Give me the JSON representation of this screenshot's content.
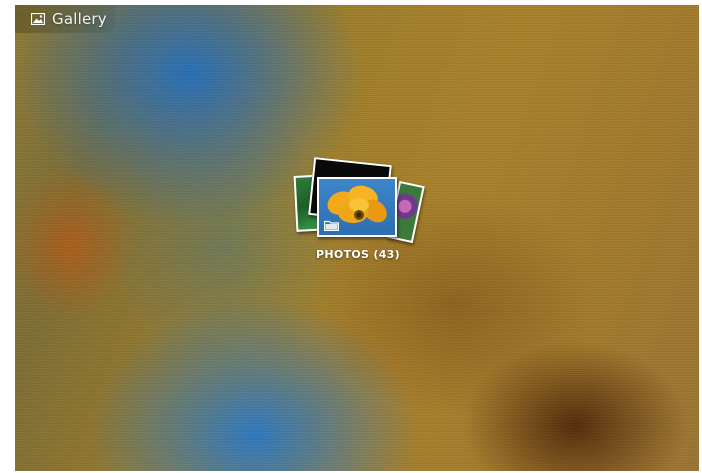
{
  "app": {
    "title": "Gallery",
    "icon": "gallery-icon"
  },
  "albums": [
    {
      "name": "PHOTOS",
      "count": 43,
      "label": "PHOTOS  (43)",
      "badge_icon": "folder-icon"
    }
  ]
}
